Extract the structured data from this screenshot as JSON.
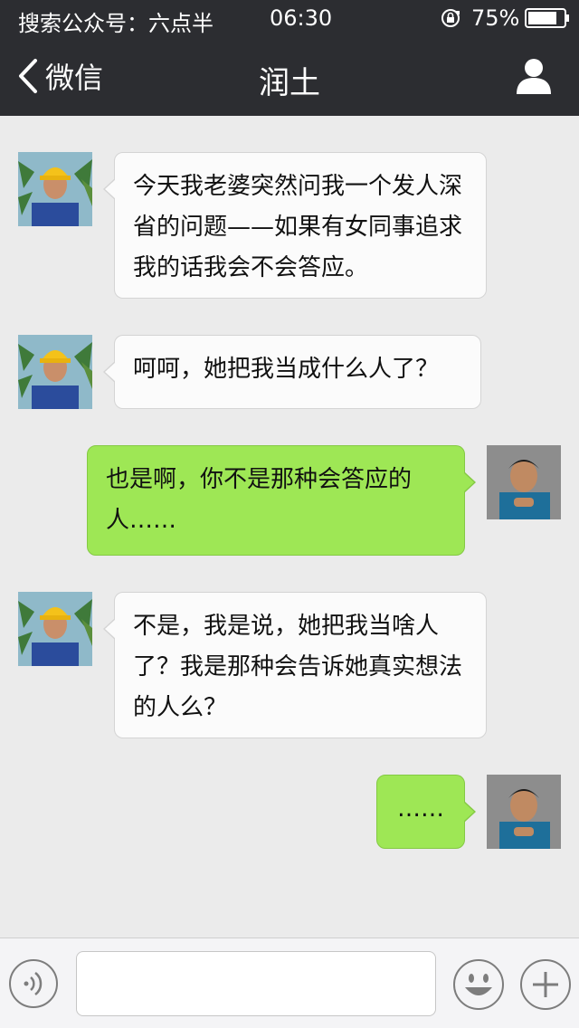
{
  "status_bar": {
    "carrier": "搜索公众号：六点半",
    "time": "06:30",
    "battery": "75%",
    "icons": [
      "rotation-lock-icon",
      "battery-icon"
    ]
  },
  "nav": {
    "back_label": "微信",
    "title": "润土",
    "icons": [
      "chevron-left-icon",
      "person-icon"
    ]
  },
  "messages": [
    {
      "side": "left",
      "sender": "润土",
      "text": "今天我老婆突然问我一个发人深省的问题——如果有女同事追求我的话我会不会答应。"
    },
    {
      "side": "left",
      "sender": "润土",
      "text": "呵呵，她把我当成什么人了？"
    },
    {
      "side": "right",
      "sender": "me",
      "text": "也是啊，你不是那种会答应的人……"
    },
    {
      "side": "left",
      "sender": "润土",
      "text": "不是，我是说，她把我当啥人了？我是那种会告诉她真实想法的人么？"
    },
    {
      "side": "right",
      "sender": "me",
      "text": "……"
    }
  ],
  "input_bar": {
    "placeholder": "",
    "icons": [
      "voice-icon",
      "emoji-icon",
      "plus-icon"
    ]
  },
  "colors": {
    "header_bg": "#2c2d31",
    "chat_bg": "#ebebeb",
    "left_bubble": "#fbfbfb",
    "right_bubble": "#9ee755"
  }
}
